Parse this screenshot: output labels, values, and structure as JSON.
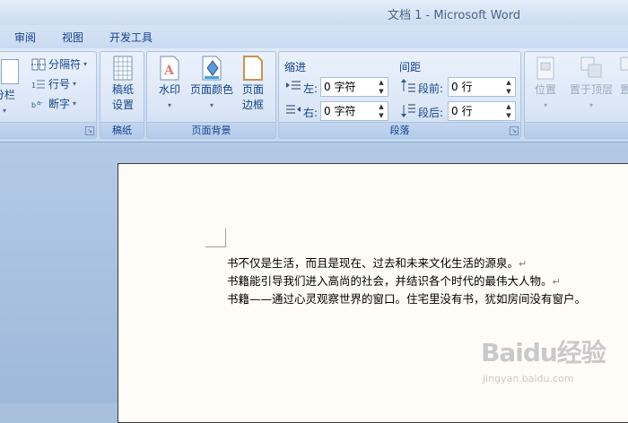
{
  "window": {
    "title": "文档 1 - Microsoft Word"
  },
  "tabs": [
    {
      "label": "审阅"
    },
    {
      "label": "视图"
    },
    {
      "label": "开发工具"
    }
  ],
  "ribbon": {
    "page_setup": {
      "columns_label": "分栏",
      "breaks_label": "分隔符",
      "line_numbers_label": "行号",
      "hyphenation_label": "断字"
    },
    "draft": {
      "button_label_1": "稿纸",
      "button_label_2": "设置",
      "group_label": "稿纸"
    },
    "page_background": {
      "watermark_label": "水印",
      "page_color_label": "页面颜色",
      "page_borders_label_1": "页面",
      "page_borders_label_2": "边框",
      "group_label": "页面背景"
    },
    "paragraph": {
      "indent_title": "缩进",
      "spacing_title": "间距",
      "left_label": "左:",
      "left_value": "0 字符",
      "right_label": "右:",
      "right_value": "0 字符",
      "before_label": "段前:",
      "before_value": "0 行",
      "after_label": "段后:",
      "after_value": "0 行",
      "group_label": "段落"
    },
    "arrange": {
      "position_label": "位置",
      "bring_front_label": "置于顶层",
      "send_back_label": "置"
    }
  },
  "document": {
    "lines": [
      "书不仅是生活，而且是现在、过去和未来文化生活的源泉。",
      "书籍能引导我们进入高尚的社会，并结识各个时代的最伟大人物。",
      "书籍——通过心灵观察世界的窗口。住宅里没有书，犹如房间没有窗户。"
    ],
    "para_mark": "↵"
  },
  "watermark": {
    "brand": "Baidu经验",
    "url": "jingyan.baidu.com"
  },
  "colors": {
    "ribbon_text": "#15428b",
    "title_text": "#4a6388",
    "page_bg": "#fffcf7"
  }
}
